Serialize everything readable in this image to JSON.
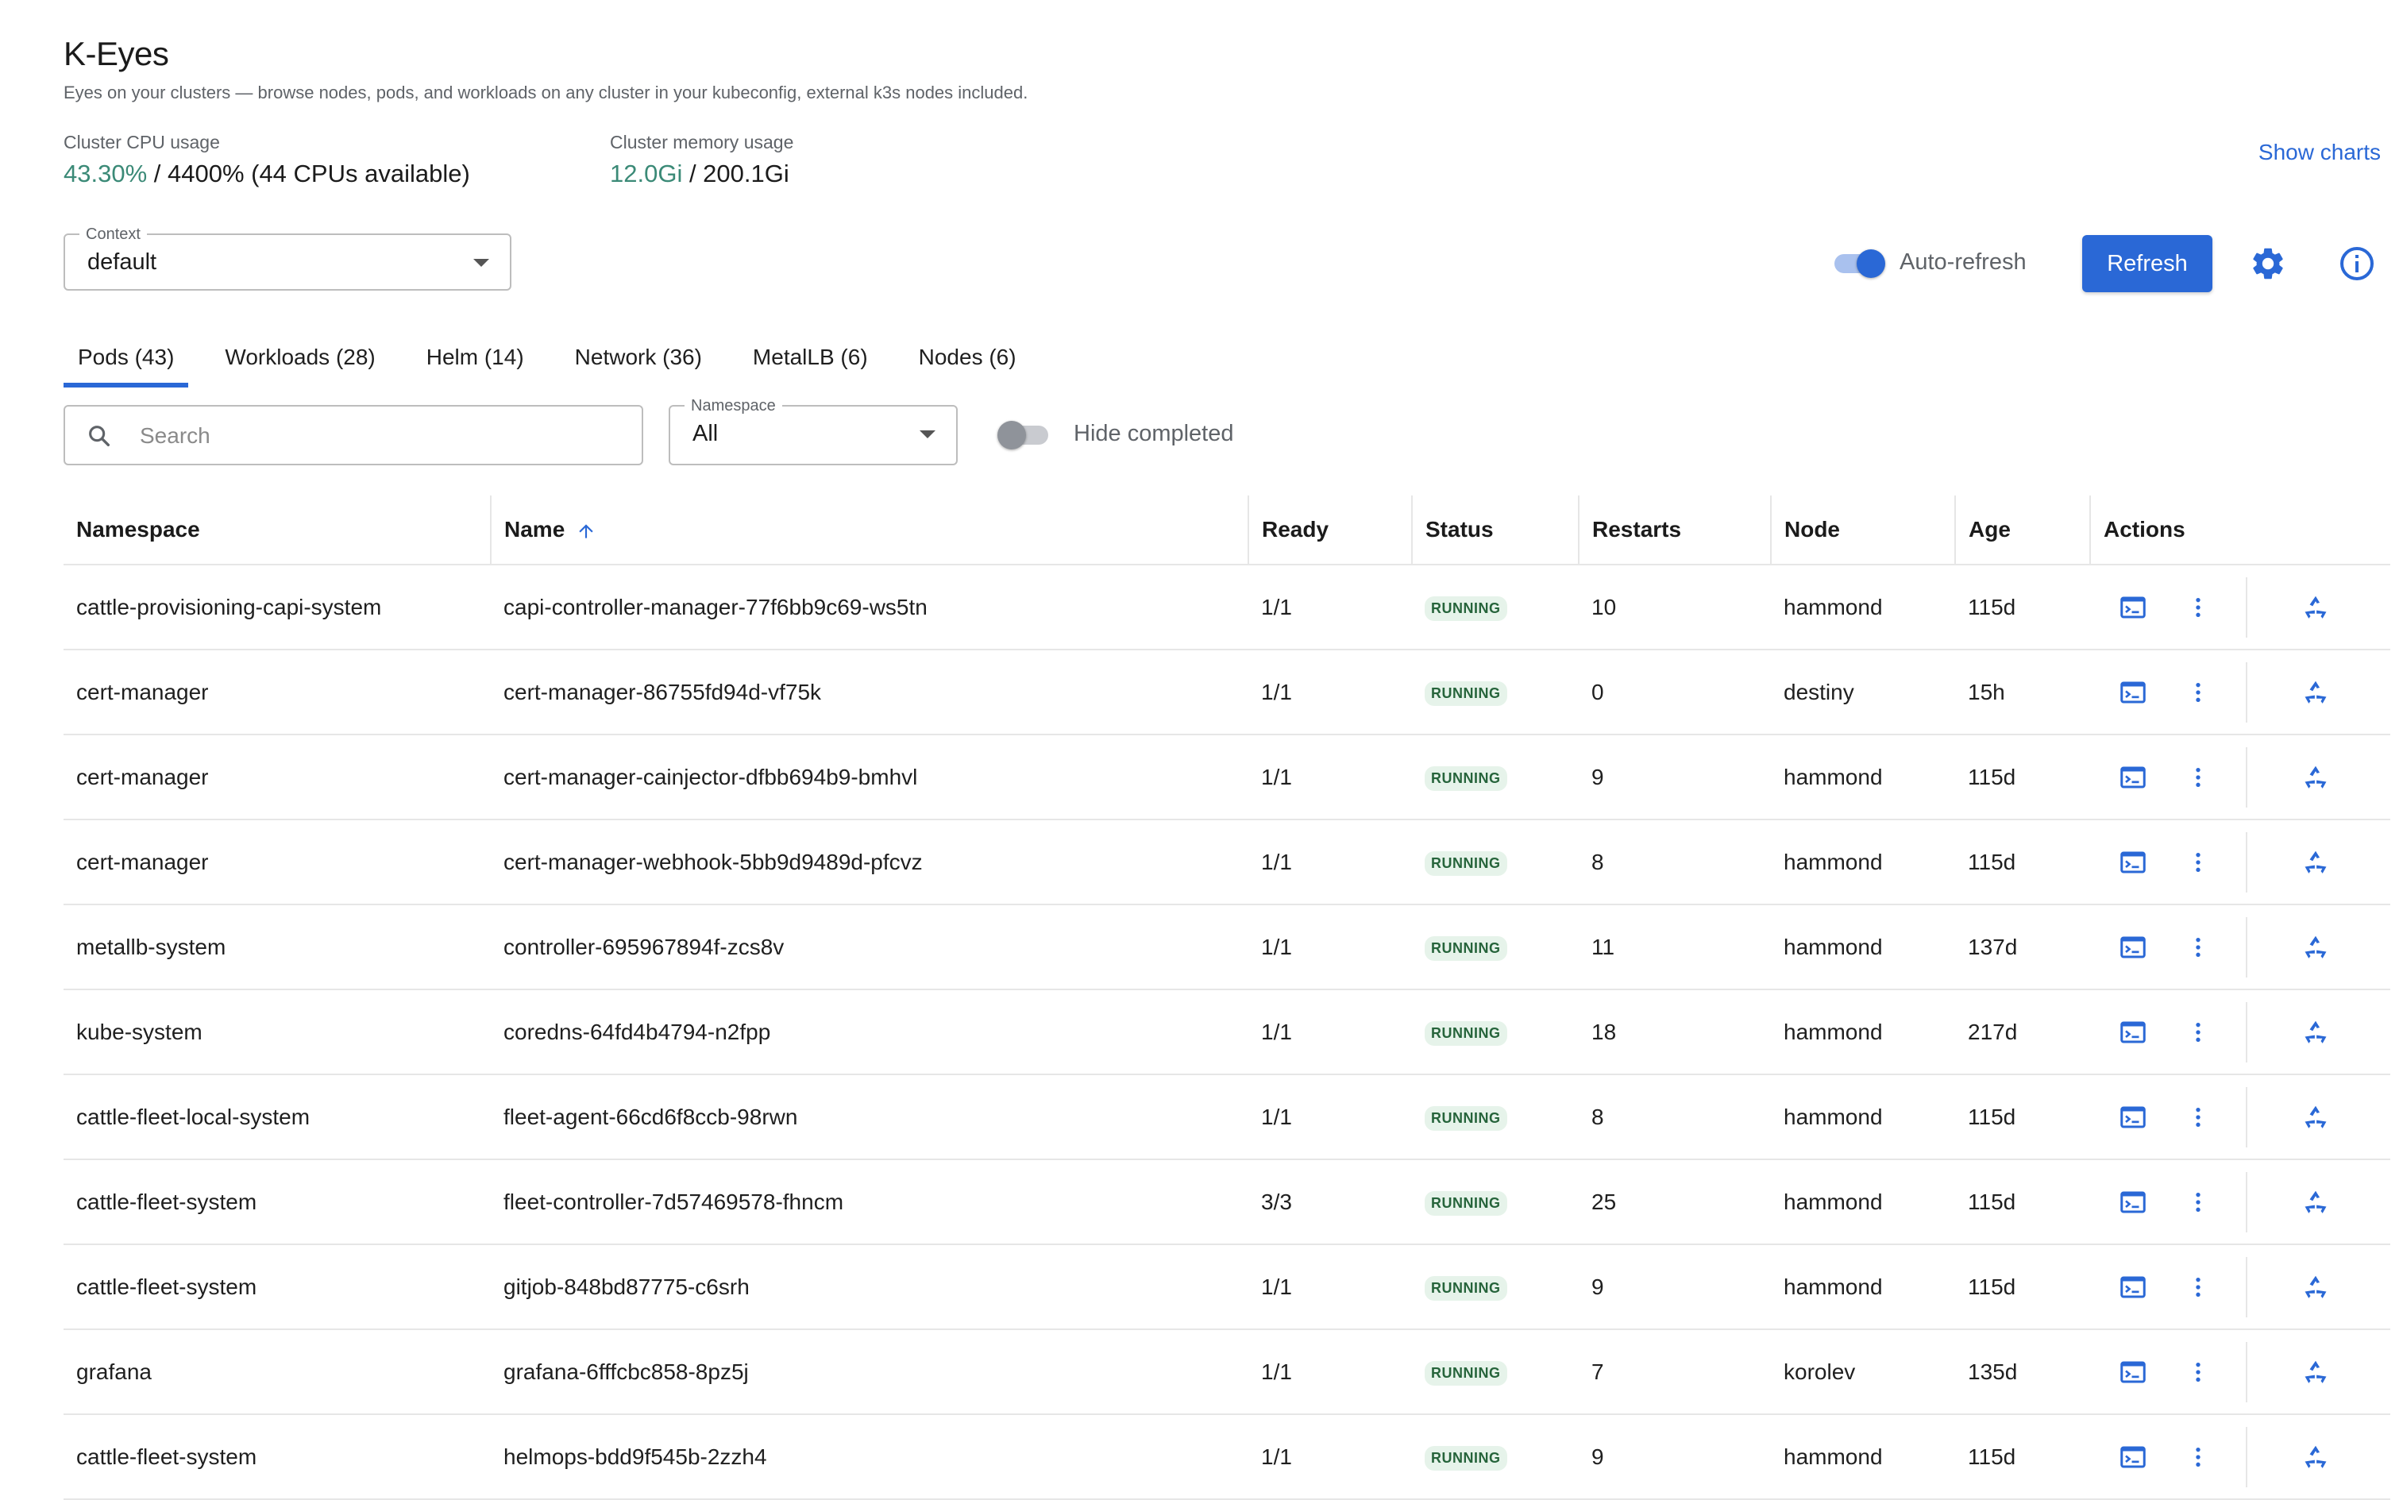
{
  "app": {
    "title": "K-Eyes",
    "subtitle": "Eyes on your clusters — browse nodes, pods, and workloads on any cluster in your kubeconfig, external k3s nodes included."
  },
  "metrics": {
    "cpu": {
      "label": "Cluster CPU usage",
      "used": "43.30%",
      "rest": " / 4400% (44 CPUs available)"
    },
    "memory": {
      "label": "Cluster memory usage",
      "used": "12.0Gi",
      "rest": " / 200.1Gi"
    },
    "show_charts": "Show charts"
  },
  "toolbar": {
    "context_label": "Context",
    "context_value": "default",
    "auto_refresh_label": "Auto-refresh",
    "auto_refresh_on": true,
    "refresh_label": "Refresh",
    "settings_icon": "gear-icon",
    "info_icon": "info-icon"
  },
  "tabs": [
    {
      "label": "Pods (43)",
      "active": true
    },
    {
      "label": "Workloads (28)",
      "active": false
    },
    {
      "label": "Helm (14)",
      "active": false
    },
    {
      "label": "Network (36)",
      "active": false
    },
    {
      "label": "MetalLB (6)",
      "active": false
    },
    {
      "label": "Nodes (6)",
      "active": false
    }
  ],
  "filters": {
    "search_placeholder": "Search",
    "namespace_label": "Namespace",
    "namespace_value": "All",
    "hide_completed_label": "Hide completed",
    "hide_completed_on": false
  },
  "table": {
    "columns": [
      "Namespace",
      "Name",
      "Ready",
      "Status",
      "Restarts",
      "Node",
      "Age",
      "Actions"
    ],
    "sorted_column": "Name",
    "sort_direction": "asc",
    "status_color": "#e6f3ea",
    "rows": [
      {
        "namespace": "cattle-provisioning-capi-system",
        "name": "capi-controller-manager-77f6bb9c69-ws5tn",
        "ready": "1/1",
        "status": "RUNNING",
        "restarts": "10",
        "node": "hammond",
        "age": "115d"
      },
      {
        "namespace": "cert-manager",
        "name": "cert-manager-86755fd94d-vf75k",
        "ready": "1/1",
        "status": "RUNNING",
        "restarts": "0",
        "node": "destiny",
        "age": "15h"
      },
      {
        "namespace": "cert-manager",
        "name": "cert-manager-cainjector-dfbb694b9-bmhvl",
        "ready": "1/1",
        "status": "RUNNING",
        "restarts": "9",
        "node": "hammond",
        "age": "115d"
      },
      {
        "namespace": "cert-manager",
        "name": "cert-manager-webhook-5bb9d9489d-pfcvz",
        "ready": "1/1",
        "status": "RUNNING",
        "restarts": "8",
        "node": "hammond",
        "age": "115d"
      },
      {
        "namespace": "metallb-system",
        "name": "controller-695967894f-zcs8v",
        "ready": "1/1",
        "status": "RUNNING",
        "restarts": "11",
        "node": "hammond",
        "age": "137d"
      },
      {
        "namespace": "kube-system",
        "name": "coredns-64fd4b4794-n2fpp",
        "ready": "1/1",
        "status": "RUNNING",
        "restarts": "18",
        "node": "hammond",
        "age": "217d"
      },
      {
        "namespace": "cattle-fleet-local-system",
        "name": "fleet-agent-66cd6f8ccb-98rwn",
        "ready": "1/1",
        "status": "RUNNING",
        "restarts": "8",
        "node": "hammond",
        "age": "115d"
      },
      {
        "namespace": "cattle-fleet-system",
        "name": "fleet-controller-7d57469578-fhncm",
        "ready": "3/3",
        "status": "RUNNING",
        "restarts": "25",
        "node": "hammond",
        "age": "115d"
      },
      {
        "namespace": "cattle-fleet-system",
        "name": "gitjob-848bd87775-c6srh",
        "ready": "1/1",
        "status": "RUNNING",
        "restarts": "9",
        "node": "hammond",
        "age": "115d"
      },
      {
        "namespace": "grafana",
        "name": "grafana-6fffcbc858-8pz5j",
        "ready": "1/1",
        "status": "RUNNING",
        "restarts": "7",
        "node": "korolev",
        "age": "135d"
      },
      {
        "namespace": "cattle-fleet-system",
        "name": "helmops-bdd9f545b-2zzh4",
        "ready": "1/1",
        "status": "RUNNING",
        "restarts": "9",
        "node": "hammond",
        "age": "115d"
      }
    ]
  },
  "colors": {
    "accent": "#2a68d6",
    "usage_highlight": "#3b8a77",
    "running_chip_text": "#26643b"
  }
}
